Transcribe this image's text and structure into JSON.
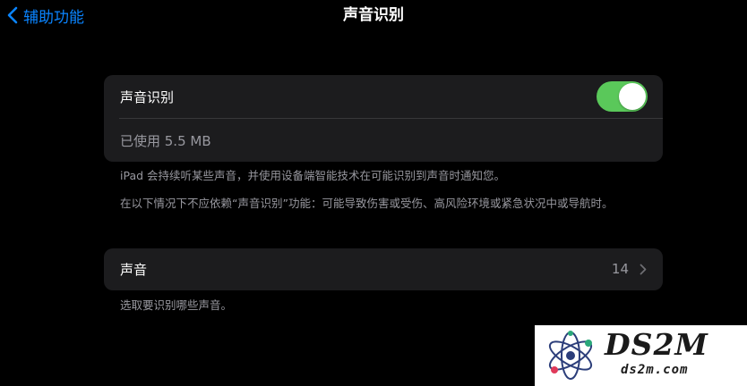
{
  "nav": {
    "back_label": "辅助功能",
    "title": "声音识别"
  },
  "group1": {
    "toggle_row_label": "声音识别",
    "toggle_on": true,
    "usage_label": "已使用 5.5 MB"
  },
  "footnotes": {
    "line1": "iPad 会持续听某些声音，并使用设备端智能技术在可能识别到声音时通知您。",
    "line2": "在以下情况下不应依赖“声音识别”功能：可能导致伤害或受伤、高风险环境或紧急状况中或导航时。",
    "sounds_hint": "选取要识别哪些声音。"
  },
  "group2": {
    "sounds_label": "声音",
    "sounds_count": "14"
  },
  "watermark": {
    "big_text": "DS2M",
    "small_text": "ds2m.com"
  },
  "colors": {
    "accent": "#0a84ff",
    "toggle_on": "#5ac85a",
    "group_bg": "#1c1c1e",
    "secondary_text": "#98989f"
  },
  "icons": {
    "back": "chevron-left-icon",
    "disclosure": "chevron-right-icon"
  }
}
